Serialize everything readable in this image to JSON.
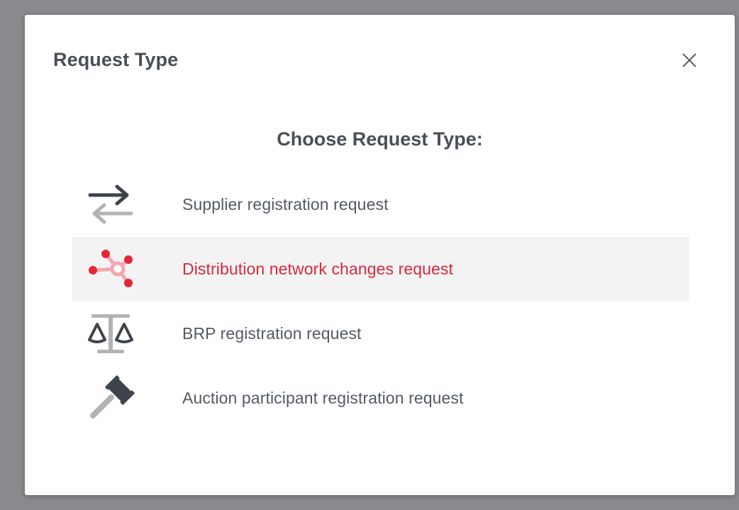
{
  "dialog": {
    "title": "Request Type",
    "close_label": "×",
    "subtitle": "Choose Request Type:"
  },
  "options": [
    {
      "label": "Supplier registration request",
      "icon": "swap-arrows-icon",
      "active": false
    },
    {
      "label": "Distribution network changes request",
      "icon": "network-nodes-icon",
      "active": true
    },
    {
      "label": "BRP registration request",
      "icon": "balance-scale-icon",
      "active": false
    },
    {
      "label": "Auction participant registration request",
      "icon": "gavel-icon",
      "active": false
    }
  ],
  "colors": {
    "backdrop": "#8a8a8e",
    "dialog_bg": "#ffffff",
    "title_text": "#4a4f57",
    "option_text": "#555a61",
    "active_text": "#d72a3c",
    "active_bg": "#f3f3f3",
    "icon_dark": "#3f444c",
    "icon_light": "#b3b3b3",
    "accent_red": "#e32636",
    "accent_pink": "#f3a7ae"
  }
}
